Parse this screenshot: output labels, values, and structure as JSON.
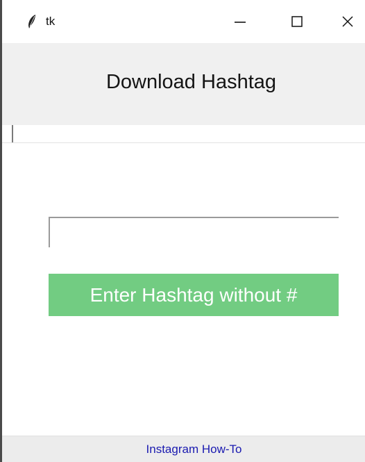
{
  "window": {
    "title": "tk",
    "icons": {
      "app": "feather-icon",
      "minimize": "minimize-icon",
      "maximize": "maximize-icon",
      "close": "close-icon"
    }
  },
  "header": {
    "label": "Download Hashtag"
  },
  "top_entry": {
    "value": ""
  },
  "hashtag_entry": {
    "value": ""
  },
  "action_button": {
    "label": "Enter Hashtag without #",
    "color": "#72cc82"
  },
  "footer": {
    "link_label": "Instagram How-To",
    "link_color": "#1a1ab0"
  }
}
